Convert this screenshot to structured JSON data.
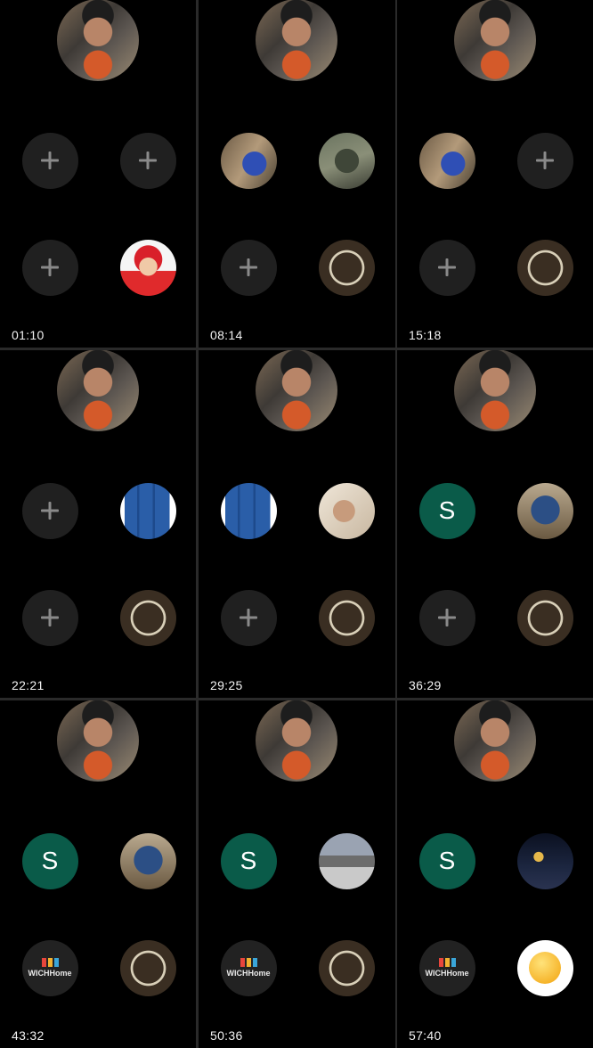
{
  "cells": [
    {
      "time": "01:10",
      "slots": [
        {
          "type": "plus"
        },
        {
          "type": "plus"
        },
        {
          "type": "plus"
        },
        {
          "type": "photo",
          "icon": "baby-photo-icon",
          "style": "p-baby"
        }
      ]
    },
    {
      "time": "08:14",
      "slots": [
        {
          "type": "photo",
          "icon": "motorbikes-photo-icon",
          "style": "p-bikes"
        },
        {
          "type": "photo",
          "icon": "tattoo-photo-icon",
          "style": "p-tattoo"
        },
        {
          "type": "plus"
        },
        {
          "type": "photo",
          "icon": "egypt-cargo-logo-icon",
          "style": "p-egypt"
        }
      ]
    },
    {
      "time": "15:18",
      "slots": [
        {
          "type": "photo",
          "icon": "motorbikes-photo-icon",
          "style": "p-bikes"
        },
        {
          "type": "plus"
        },
        {
          "type": "plus"
        },
        {
          "type": "photo",
          "icon": "egypt-cargo-logo-icon",
          "style": "p-egypt"
        }
      ]
    },
    {
      "time": "22:21",
      "slots": [
        {
          "type": "plus"
        },
        {
          "type": "photo",
          "icon": "luggage-photo-icon",
          "style": "p-luggage"
        },
        {
          "type": "plus"
        },
        {
          "type": "photo",
          "icon": "egypt-cargo-logo-icon",
          "style": "p-egypt"
        }
      ]
    },
    {
      "time": "29:25",
      "slots": [
        {
          "type": "photo",
          "icon": "luggage-photo-icon",
          "style": "p-luggage"
        },
        {
          "type": "photo",
          "icon": "mirror-selfie-photo-icon",
          "style": "p-mirror"
        },
        {
          "type": "plus"
        },
        {
          "type": "photo",
          "icon": "egypt-cargo-logo-icon",
          "style": "p-egypt"
        }
      ]
    },
    {
      "time": "36:29",
      "slots": [
        {
          "type": "letter",
          "letter": "S"
        },
        {
          "type": "photo",
          "icon": "cap-photo-icon",
          "style": "p-cap"
        },
        {
          "type": "plus"
        },
        {
          "type": "photo",
          "icon": "egypt-cargo-logo-icon",
          "style": "p-egypt"
        }
      ]
    },
    {
      "time": "43:32",
      "slots": [
        {
          "type": "letter",
          "letter": "S"
        },
        {
          "type": "photo",
          "icon": "cap-photo-icon",
          "style": "p-cap"
        },
        {
          "type": "photo",
          "icon": "wichhome-logo-icon",
          "style": "p-home"
        },
        {
          "type": "photo",
          "icon": "egypt-cargo-logo-icon",
          "style": "p-egypt"
        }
      ]
    },
    {
      "time": "50:36",
      "slots": [
        {
          "type": "letter",
          "letter": "S"
        },
        {
          "type": "photo",
          "icon": "street-photo-icon",
          "style": "p-street"
        },
        {
          "type": "photo",
          "icon": "wichhome-logo-icon",
          "style": "p-home"
        },
        {
          "type": "photo",
          "icon": "egypt-cargo-logo-icon",
          "style": "p-egypt"
        }
      ]
    },
    {
      "time": "57:40",
      "slots": [
        {
          "type": "letter",
          "letter": "S"
        },
        {
          "type": "photo",
          "icon": "paris-night-photo-icon",
          "style": "p-paris"
        },
        {
          "type": "photo",
          "icon": "wichhome-logo-icon",
          "style": "p-home"
        },
        {
          "type": "photo",
          "icon": "emoji-sticker-icon",
          "style": "p-emoji"
        }
      ]
    }
  ],
  "host_avatar_icon": "host-profile-photo-icon"
}
